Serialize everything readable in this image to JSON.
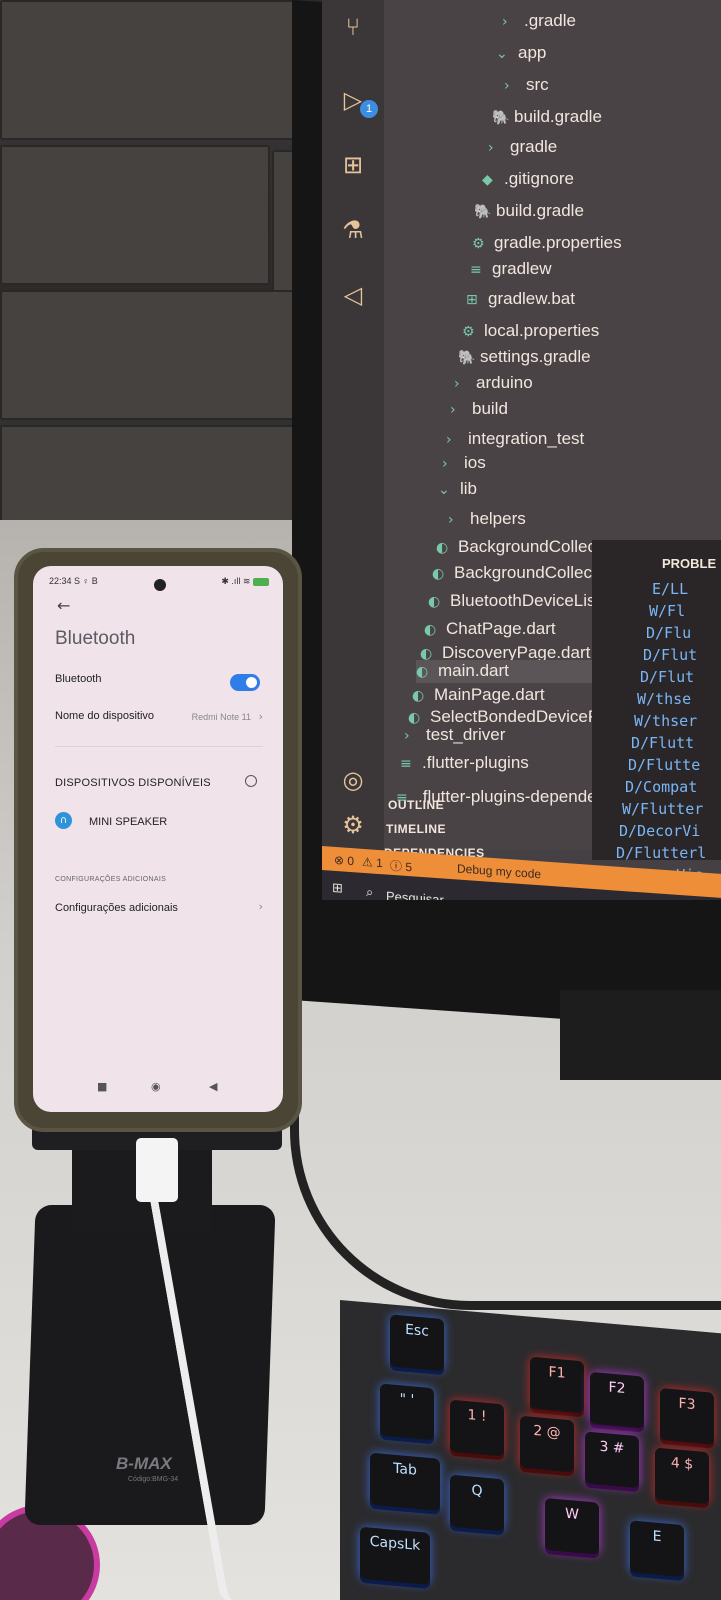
{
  "monitor": {
    "explorer_items": [
      {
        "label": ".gradle",
        "icon": "chevron-right"
      },
      {
        "label": "app",
        "icon": "chevron-down"
      },
      {
        "label": "src",
        "icon": "chevron-right"
      },
      {
        "label": "build.gradle",
        "icon": "gradle-icon"
      },
      {
        "label": "gradle",
        "icon": "chevron-right"
      },
      {
        "label": ".gitignore",
        "icon": "git-icon"
      },
      {
        "label": "build.gradle",
        "icon": "gradle-icon"
      },
      {
        "label": "gradle.properties",
        "icon": "gear-icon"
      },
      {
        "label": "gradlew",
        "icon": "file-icon"
      },
      {
        "label": "gradlew.bat",
        "icon": "windows-icon"
      },
      {
        "label": "local.properties",
        "icon": "gear-icon"
      },
      {
        "label": "settings.gradle",
        "icon": "gradle-icon"
      },
      {
        "label": "arduino",
        "icon": "chevron-right"
      },
      {
        "label": "build",
        "icon": "chevron-right"
      },
      {
        "label": "integration_test",
        "icon": "chevron-right"
      },
      {
        "label": "ios",
        "icon": "chevron-right"
      },
      {
        "label": "lib",
        "icon": "chevron-down"
      },
      {
        "label": "helpers",
        "icon": "chevron-right"
      },
      {
        "label": "BackgroundCollectedPage....",
        "icon": "dart-icon"
      },
      {
        "label": "BackgroundCollectingTask....",
        "icon": "dart-icon"
      },
      {
        "label": "BluetoothDeviceListEntry.dart",
        "icon": "dart-icon"
      },
      {
        "label": "ChatPage.dart",
        "icon": "dart-icon"
      },
      {
        "label": "DiscoveryPage.dart",
        "icon": "dart-icon"
      },
      {
        "label": "main.dart",
        "icon": "dart-icon"
      },
      {
        "label": "MainPage.dart",
        "icon": "dart-icon"
      },
      {
        "label": "SelectBondedDevicePage.d...",
        "icon": "dart-icon"
      },
      {
        "label": "test_driver",
        "icon": "chevron-right"
      },
      {
        "label": ".flutter-plugins",
        "icon": "file-icon"
      },
      {
        "label": ".flutter-plugins-dependencies",
        "icon": "file-icon"
      }
    ],
    "selected_item": "main.dart",
    "sections": [
      "OUTLINE",
      "TIMELINE",
      "DEPENDENCIES"
    ],
    "panel_title": "PROBLE",
    "output_lines": [
      "E/LL",
      "W/Fl",
      "D/Flu",
      "D/Flut",
      "D/Flut",
      "W/thse",
      "W/thser",
      "D/Flutt",
      "D/Flutte",
      "D/Compat",
      "W/Flutter",
      "D/DecorVi",
      "D/Flutterl",
      "D/DecorVie"
    ],
    "status": {
      "errors": "0",
      "warnings": "1",
      "info": "5",
      "debug_label": "Debug my code"
    },
    "taskbar": {
      "search_label": "Pesquisar"
    },
    "update_badge": "1"
  },
  "phone": {
    "status_time": "22:34",
    "status_left_icons": "S ♀ B",
    "status_right_icons": "✱ .ıll ≋",
    "title": "Bluetooth",
    "bluetooth_label": "Bluetooth",
    "bluetooth_on": true,
    "device_name_label": "Nome do dispositivo",
    "device_name_value": "Redmi Note 11",
    "available_devices_label": "DISPOSITIVOS DISPONÍVEIS",
    "device": "MINI SPEAKER",
    "additional_header": "CONFIGURAÇÕES ADICIONAIS",
    "additional_settings": "Configurações adicionais",
    "nav_back": "◀",
    "nav_home": "◉",
    "nav_recent": "■"
  },
  "stand": {
    "brand": "B-MAX",
    "code": "Código:BMG-34"
  },
  "keyboard": {
    "keys": [
      "Esc",
      "F1",
      "F2",
      "F3",
      "\" '",
      "1 !",
      "2 @",
      "3 #",
      "4 $",
      "Tab",
      "Q",
      "W",
      "E",
      "CapsLk"
    ]
  },
  "colors": {
    "accent_orange": "#ee8e39",
    "toggle_blue": "#2f7de8",
    "dart_icon": "#78c9a8"
  }
}
